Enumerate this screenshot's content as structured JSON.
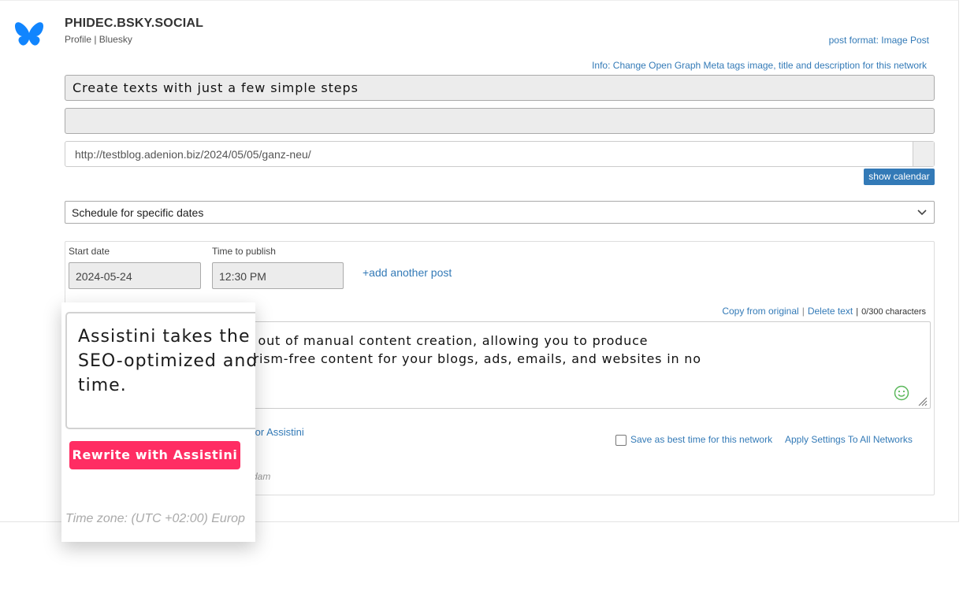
{
  "network": {
    "title": "PHIDEC.BSKY.SOCIAL",
    "subtitle": "Profile | Bluesky",
    "icon": "butterfly-icon",
    "brand_color": "#1185fe"
  },
  "post_format": "post format: Image Post",
  "og_info": "Info: Change Open Graph Meta tags image, title and description for this network",
  "title_field": {
    "value": "Create texts with just a few simple steps"
  },
  "description_field": {
    "value": ""
  },
  "url_field": {
    "value": "http://testblog.adenion.biz/2024/05/05/ganz-neu/"
  },
  "show_calendar": "show calendar",
  "schedule_select": {
    "selected": "Schedule for specific dates"
  },
  "schedule": {
    "start_date_label": "Start date",
    "start_date": "2024-05-24",
    "time_label": "Time to publish",
    "time": "12:30 PM",
    "add_post": "+add another post"
  },
  "text_links": {
    "copy": "Copy from original",
    "delete": "Delete text",
    "count": "0/300 characters"
  },
  "post_text": {
    "line1": "e out of manual content creation, allowing you to produce",
    "line2": "arism-free content for your blogs, ads, emails, and websites in no"
  },
  "for_assistini": "for Assistini",
  "best_time": "Save as best time for this network",
  "apply_all": "Apply Settings To All Networks",
  "tz_fragment": "dam",
  "popup": {
    "line1": "Assistini takes the",
    "line2": "SEO-optimized and",
    "line3": "time.",
    "button": "Rewrite with Assistini",
    "timezone": "Time zone: (UTC +02:00) Europ",
    "button_color": "#ff2d63"
  },
  "accent_color": "#337ab7"
}
